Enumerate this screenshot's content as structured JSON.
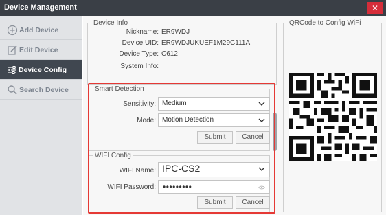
{
  "window": {
    "title": "Device Management",
    "close_icon": "close-icon"
  },
  "sidebar": {
    "items": [
      {
        "label": "Add Device",
        "icon": "plus-circle-icon",
        "active": false
      },
      {
        "label": "Edit Device",
        "icon": "edit-icon",
        "active": false
      },
      {
        "label": "Device Config",
        "icon": "sliders-icon",
        "active": true
      },
      {
        "label": "Search Device",
        "icon": "search-icon",
        "active": false
      }
    ]
  },
  "device_info": {
    "title": "Device Info",
    "nickname_label": "Nickname:",
    "nickname": "ER9WDJ",
    "uid_label": "Device UID:",
    "uid": "ER9WDJUKUEF1M29C111A",
    "type_label": "Device Type:",
    "type": "C612",
    "system_label": "System Info:",
    "system": ""
  },
  "smart_detection": {
    "title": "Smart Detection",
    "sensitivity_label": "Sensitivity:",
    "sensitivity_value": "Medium",
    "mode_label": "Mode:",
    "mode_value": "Motion Detection",
    "submit_label": "Submit",
    "cancel_label": "Cancel"
  },
  "wifi_config": {
    "title": "WIFI Config",
    "name_label": "WIFI Name:",
    "name_value": "IPC-CS2",
    "password_label": "WIFI Password:",
    "password_mask": "•••••••••",
    "submit_label": "Submit",
    "cancel_label": "Cancel"
  },
  "qrcode": {
    "title": "QRCode to Config WiFi"
  },
  "colors": {
    "accent_red": "#e53935",
    "titlebar": "#3a3f46",
    "sidebar_active": "#404750",
    "close_button": "#d62d3a"
  }
}
